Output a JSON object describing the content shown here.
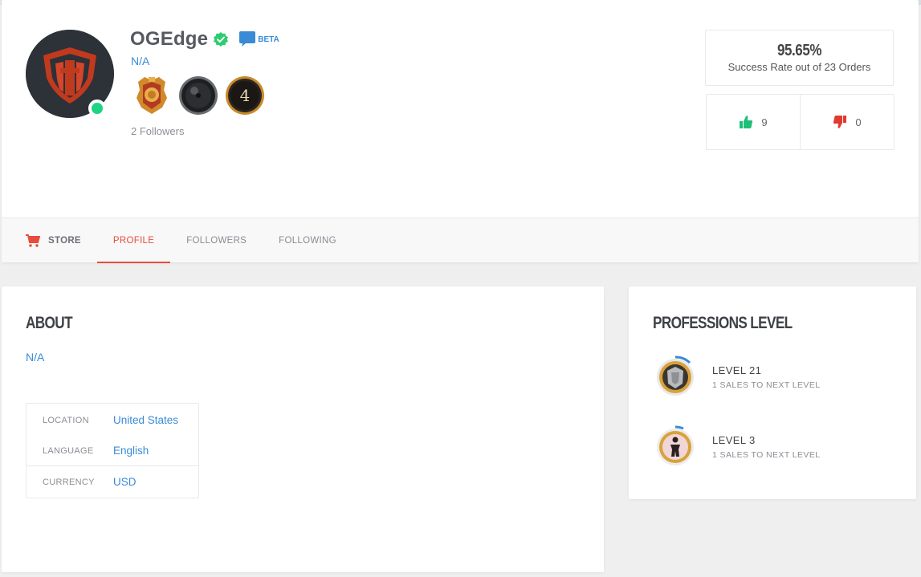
{
  "profile": {
    "username": "OGEdge",
    "beta_label": "BETA",
    "subtitle": "N/A",
    "followers_text": "2 Followers",
    "badge_level": "4",
    "online": true
  },
  "stats": {
    "success_rate": "95.65%",
    "success_label": "Success Rate out of 23 Orders",
    "thumbs_up": "9",
    "thumbs_down": "0"
  },
  "nav": {
    "store": "STORE",
    "tabs": [
      {
        "label": "PROFILE",
        "active": true
      },
      {
        "label": "FOLLOWERS",
        "active": false
      },
      {
        "label": "FOLLOWING",
        "active": false
      }
    ]
  },
  "about": {
    "title": "ABOUT",
    "text": "N/A",
    "info": [
      {
        "key": "LOCATION",
        "value": "United States"
      },
      {
        "key": "LANGUAGE",
        "value": "English"
      },
      {
        "key": "CURRENCY",
        "value": "USD"
      }
    ]
  },
  "professions": {
    "title": "PROFESSIONS LEVEL",
    "items": [
      {
        "level": "LEVEL 21",
        "sub": "1 SALES TO NEXT LEVEL",
        "icon": "armor-icon"
      },
      {
        "level": "LEVEL 3",
        "sub": "1 SALES TO NEXT LEVEL",
        "icon": "figure-icon"
      }
    ]
  },
  "colors": {
    "accent_red": "#e74c3c",
    "link_blue": "#3a8bd6",
    "online_green": "#1ed484",
    "verified_green": "#2ecc71"
  }
}
